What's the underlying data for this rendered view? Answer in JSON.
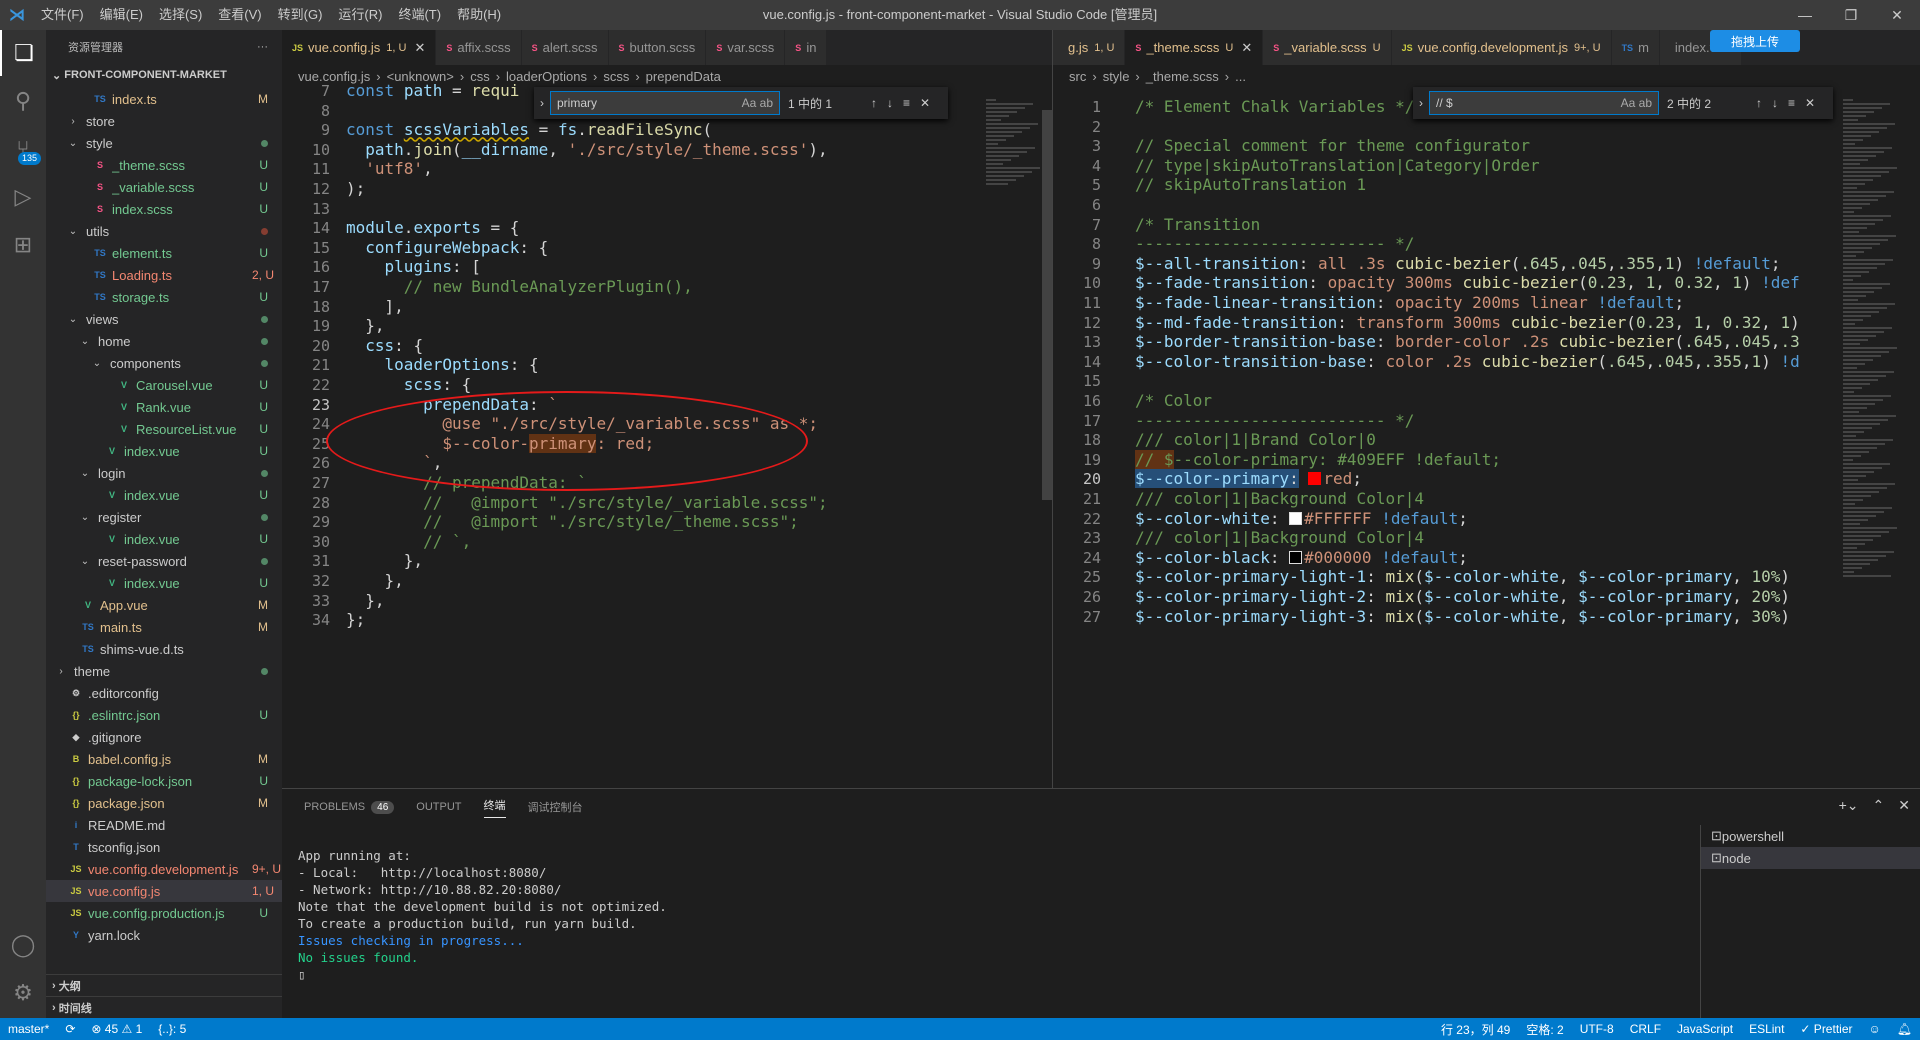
{
  "titlebar": {
    "menus": [
      "文件(F)",
      "编辑(E)",
      "选择(S)",
      "查看(V)",
      "转到(G)",
      "运行(R)",
      "终端(T)",
      "帮助(H)"
    ],
    "title": "vue.config.js - front-component-market - Visual Studio Code [管理员]"
  },
  "activity": {
    "scm_badge": "135"
  },
  "sidebar": {
    "header": "资源管理器",
    "more": "···",
    "root": "FRONT-COMPONENT-MARKET",
    "items": [
      {
        "name": "index.ts",
        "icon": "TS",
        "status": "M",
        "indent": 1
      },
      {
        "name": "store",
        "icon": ">",
        "status": "",
        "indent": 0
      },
      {
        "name": "style",
        "icon": "v",
        "status": "dot",
        "indent": 0
      },
      {
        "name": "_theme.scss",
        "icon": "S",
        "status": "U",
        "indent": 1
      },
      {
        "name": "_variable.scss",
        "icon": "S",
        "status": "U",
        "indent": 1
      },
      {
        "name": "index.scss",
        "icon": "S",
        "status": "U",
        "indent": 1
      },
      {
        "name": "utils",
        "icon": "v",
        "status": "dotr",
        "indent": 0
      },
      {
        "name": "element.ts",
        "icon": "TS",
        "status": "U",
        "indent": 1
      },
      {
        "name": "Loading.ts",
        "icon": "TS",
        "status": "2, U",
        "indent": 1
      },
      {
        "name": "storage.ts",
        "icon": "TS",
        "status": "U",
        "indent": 1
      },
      {
        "name": "views",
        "icon": "v",
        "status": "dot",
        "indent": 0
      },
      {
        "name": "home",
        "icon": "v",
        "status": "dot",
        "indent": 1
      },
      {
        "name": "components",
        "icon": "v",
        "status": "dot",
        "indent": 2
      },
      {
        "name": "Carousel.vue",
        "icon": "V",
        "status": "U",
        "indent": 3
      },
      {
        "name": "Rank.vue",
        "icon": "V",
        "status": "U",
        "indent": 3
      },
      {
        "name": "ResourceList.vue",
        "icon": "V",
        "status": "U",
        "indent": 3
      },
      {
        "name": "index.vue",
        "icon": "V",
        "status": "U",
        "indent": 2
      },
      {
        "name": "login",
        "icon": "v",
        "status": "dot",
        "indent": 1
      },
      {
        "name": "index.vue",
        "icon": "V",
        "status": "U",
        "indent": 2
      },
      {
        "name": "register",
        "icon": "v",
        "status": "dot",
        "indent": 1
      },
      {
        "name": "index.vue",
        "icon": "V",
        "status": "U",
        "indent": 2
      },
      {
        "name": "reset-password",
        "icon": "v",
        "status": "dot",
        "indent": 1
      },
      {
        "name": "index.vue",
        "icon": "V",
        "status": "U",
        "indent": 2
      },
      {
        "name": "App.vue",
        "icon": "V",
        "status": "M",
        "indent": 0
      },
      {
        "name": "main.ts",
        "icon": "TS",
        "status": "M",
        "indent": 0
      },
      {
        "name": "shims-vue.d.ts",
        "icon": "TS",
        "status": "",
        "indent": 0
      },
      {
        "name": "theme",
        "icon": ">",
        "status": "dot",
        "indent": -1
      },
      {
        "name": ".editorconfig",
        "icon": "⚙",
        "status": "",
        "indent": -1
      },
      {
        "name": ".eslintrc.json",
        "icon": "{}",
        "status": "U",
        "indent": -1
      },
      {
        "name": ".gitignore",
        "icon": "◆",
        "status": "",
        "indent": -1
      },
      {
        "name": "babel.config.js",
        "icon": "B",
        "status": "M",
        "indent": -1
      },
      {
        "name": "package-lock.json",
        "icon": "{}",
        "status": "U",
        "indent": -1
      },
      {
        "name": "package.json",
        "icon": "{}",
        "status": "M",
        "indent": -1
      },
      {
        "name": "README.md",
        "icon": "i",
        "status": "",
        "indent": -1
      },
      {
        "name": "tsconfig.json",
        "icon": "T",
        "status": "",
        "indent": -1
      },
      {
        "name": "vue.config.development.js",
        "icon": "JS",
        "status": "9+, U",
        "indent": -1
      },
      {
        "name": "vue.config.js",
        "icon": "JS",
        "status": "1, U",
        "indent": -1
      },
      {
        "name": "vue.config.production.js",
        "icon": "JS",
        "status": "U",
        "indent": -1
      },
      {
        "name": "yarn.lock",
        "icon": "Y",
        "status": "",
        "indent": -1
      }
    ],
    "outline": "大纲",
    "timeline": "时间线"
  },
  "left_editor": {
    "tabs": [
      {
        "name": "vue.config.js",
        "meta": "1, U",
        "icon": "JS",
        "active": true
      },
      {
        "name": "affix.scss",
        "icon": "S"
      },
      {
        "name": "alert.scss",
        "icon": "S"
      },
      {
        "name": "button.scss",
        "icon": "S"
      },
      {
        "name": "var.scss",
        "icon": "S"
      },
      {
        "name": "in",
        "icon": "S"
      }
    ],
    "breadcrumb": [
      "vue.config.js",
      "<unknown>",
      "css",
      "loaderOptions",
      "scss",
      "prependData"
    ],
    "find": {
      "value": "primary",
      "count": "1 中的 1"
    },
    "line_numbers": [
      "7",
      "8",
      "9",
      "10",
      "11",
      "12",
      "13",
      "14",
      "15",
      "16",
      "17",
      "18",
      "19",
      "20",
      "21",
      "22",
      "23",
      "24",
      "25",
      "26",
      "27",
      "28",
      "29",
      "30",
      "31",
      "32",
      "33",
      "34"
    ],
    "current_line": "23",
    "top_partial": "const path = requi"
  },
  "right_editor": {
    "tabs": [
      {
        "name": "g.js",
        "meta": "1, U",
        "icon": ""
      },
      {
        "name": "_theme.scss",
        "meta": "U",
        "icon": "S",
        "active": true
      },
      {
        "name": "_variable.scss",
        "meta": "U",
        "icon": "S"
      },
      {
        "name": "vue.config.development.js",
        "meta": "9+, U",
        "icon": "JS"
      },
      {
        "name": "m",
        "icon": "TS"
      },
      {
        "name": "index.vue",
        "icon": ""
      }
    ],
    "breadcrumb": [
      "src",
      "style",
      "_theme.scss",
      "..."
    ],
    "find": {
      "value": "// $",
      "count": "2 中的 2"
    },
    "line_numbers": [
      "1",
      "2",
      "3",
      "4",
      "5",
      "6",
      "7",
      "8",
      "9",
      "10",
      "11",
      "12",
      "13",
      "14",
      "15",
      "16",
      "17",
      "18",
      "19",
      "20",
      "21",
      "22",
      "23",
      "24",
      "25",
      "26",
      "27"
    ],
    "current_line": "20"
  },
  "upload_label": "拖拽上传",
  "panel": {
    "tabs": [
      "PROBLEMS",
      "OUTPUT",
      "终端",
      "调试控制台"
    ],
    "problems_count": "46",
    "terminal": [
      "App running at:",
      "- Local:   http://localhost:8080/",
      "- Network: http://10.88.82.20:8080/",
      "",
      "Note that the development build is not optimized.",
      "To create a production build, run yarn build.",
      "",
      "Issues checking in progress...",
      "No issues found."
    ],
    "terminals": [
      "powershell",
      "node"
    ]
  },
  "statusbar": {
    "branch": "master*",
    "sync": "⟳",
    "errors": "⊗ 45 ⚠ 1",
    "braces": "{..}: 5",
    "position": "行 23，列 49",
    "spaces": "空格: 2",
    "encoding": "UTF-8",
    "eol": "CRLF",
    "lang": "JavaScript",
    "eslint": "ESLint",
    "prettier": "✓ Prettier"
  },
  "colors": {
    "accent": "#007acc",
    "circle": "#e51a1a"
  }
}
